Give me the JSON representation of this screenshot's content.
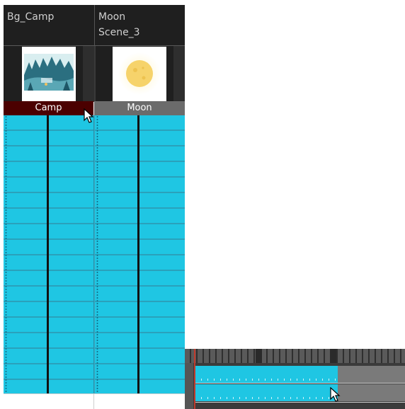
{
  "xsheet": {
    "columns": [
      {
        "header_line1": "Bg_Camp",
        "header_line2": "",
        "drawing_name": "Camp",
        "thumbnail": "camp-landscape-icon"
      },
      {
        "header_line1": "Moon",
        "header_line2": "Scene_3",
        "drawing_name": "Moon",
        "thumbnail": "moon-icon"
      }
    ],
    "selected_column": "Camp",
    "cell_rows": 18
  },
  "timeline": {
    "layers": [
      {
        "exposure_fill": 0.68
      },
      {
        "exposure_fill": 0.68
      }
    ]
  },
  "colors": {
    "cell_fill": "#1fc6e3",
    "selected_header": "#4b0000",
    "header_bg": "#1f1f1f",
    "playhead": "#c0392b"
  }
}
